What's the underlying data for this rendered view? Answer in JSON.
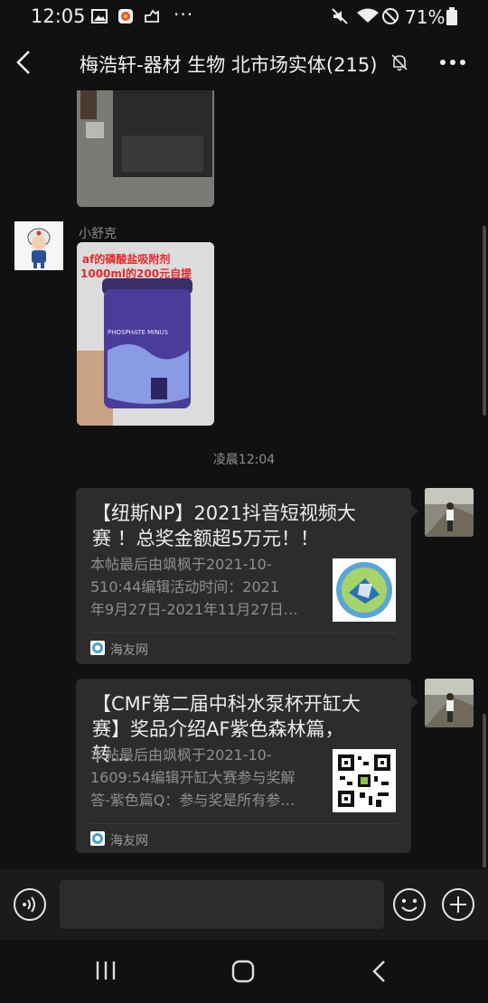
{
  "status": {
    "time": "12:05",
    "battery": "71%",
    "icons": [
      "gallery-icon",
      "app-icon",
      "share-icon",
      "more-dots-icon",
      "mute-icon",
      "wifi-icon",
      "dnd-icon",
      "battery-icon"
    ]
  },
  "header": {
    "title": "梅浩轩-器材 生物 北市场实体(215)",
    "back_icon": "back-arrow-icon",
    "muted_icon": "bell-off-icon",
    "more_icon": "more-horizontal-icon"
  },
  "messages": [
    {
      "type": "image",
      "sender": "",
      "side": "left",
      "image_desc": "photo"
    },
    {
      "type": "image",
      "side": "left",
      "sender": "小舒克",
      "overlay_line1": "af的磷酸盐吸附剂",
      "overlay_line2": "1000ml的200元自提",
      "label_text": "PHOSPHATE MINUS"
    },
    {
      "type": "time",
      "text": "凌晨12:04"
    },
    {
      "type": "link",
      "side": "right",
      "title": "【纽斯NP】2021抖音短视频大赛 ！总奖金额超5万元！！",
      "title_line1": "【纽斯NP】2021抖音短视频大",
      "title_line2": "赛 ！总奖金额超5万元！！",
      "desc_line1": "本帖最后由飒枫于2021-10-",
      "desc_line2": "510:44编辑活动时间：2021",
      "desc_line3": "年9月27日-2021年11月27日…",
      "source": "海友网"
    },
    {
      "type": "link",
      "side": "right",
      "title_line1": "【CMF第二届中科水泵杯开缸大",
      "title_line2": "赛】奖品介绍AF紫色森林篇，转…",
      "desc_line1": "本帖最后由飒枫于2021-10-",
      "desc_line2": "1609:54编辑开缸大赛参与奖解",
      "desc_line3": "答-紫色篇Q：参与奖是所有参…",
      "source": "海友网"
    }
  ],
  "input": {
    "placeholder": "",
    "value": ""
  },
  "colors": {
    "background": "#111111",
    "card": "#2c2c2c",
    "accent_blue": "#4a5bd0"
  }
}
